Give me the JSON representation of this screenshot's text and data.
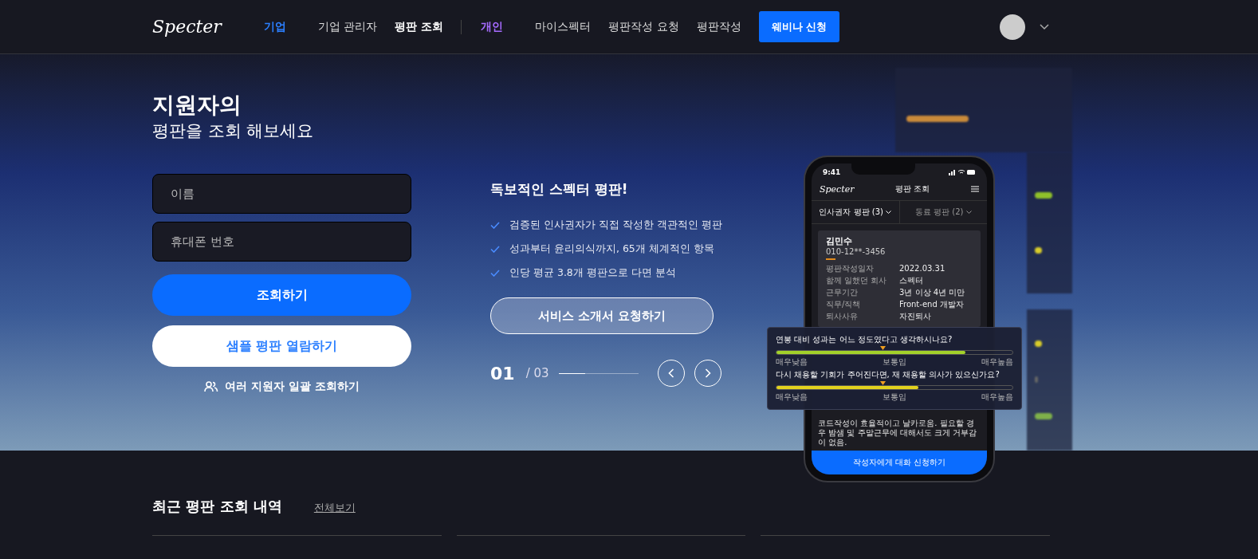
{
  "nav": {
    "logo": "Specter",
    "groups": [
      {
        "label": "기업",
        "color": "#2b7fff",
        "items": [
          {
            "label": "기업 관리자",
            "selected": false
          },
          {
            "label": "평판 조회",
            "selected": true
          }
        ]
      },
      {
        "label": "개인",
        "color": "#a66bff",
        "items": [
          {
            "label": "마이스펙터",
            "selected": false
          },
          {
            "label": "평판작성 요청",
            "selected": false
          },
          {
            "label": "평판작성",
            "selected": false
          }
        ]
      }
    ],
    "cta": "웨비나 신청"
  },
  "hero": {
    "title": "지원자의",
    "subtitle": "평판을 조회 해보세요",
    "fields": [
      {
        "placeholder": "이름"
      },
      {
        "placeholder": "휴대폰 번호"
      }
    ],
    "search_button": "조회하기",
    "sample_button": "샘플 평판 열람하기",
    "bulk_link": "여러 지원자 일괄 조회하기"
  },
  "feature": {
    "heading": "독보적인 스펙터 평판!",
    "points": [
      "검증된 인사권자가 직접 작성한 객관적인 평판",
      "성과부터 윤리의식까지, 65개 체계적인 항목",
      "인당 평균 3.8개 평판으로 다면 분석"
    ],
    "button": "서비스 소개서 요청하기",
    "page": "01",
    "total": "/ 03",
    "progress": {
      "level": 0.33
    }
  },
  "phone": {
    "time": "9:41",
    "logo": "Specter",
    "title": "평판 조회",
    "tabs": [
      {
        "label": "인사권자 평판 (3)",
        "selected": true
      },
      {
        "label": "동료 평판 (2)",
        "selected": false
      }
    ],
    "name": "김민수",
    "number": "010-12**-3456",
    "rows": [
      {
        "label": "평판작성일자",
        "value": "2022.03.31"
      },
      {
        "label": "함께 일했던 회사",
        "value": "스펙터"
      },
      {
        "label": "근무기간",
        "value": "3년 이상 4년 미만"
      },
      {
        "label": "직무/직책",
        "value": "Front-end 개발자"
      },
      {
        "label": "퇴사사유",
        "value": "자진퇴사"
      }
    ],
    "comment": "코드작성이 효율적이고 날카로움. 필요할 경우 밤샘 및 주말근무에 대해서도 크게 거부감이 없음.",
    "button": "작성자에게 대화 신청하기"
  },
  "rating_card": {
    "questions": [
      {
        "text": "연봉 대비 성과는 어느 정도였다고 생각하시나요?",
        "level": 0.8,
        "color": "#a3d12a",
        "low": "매우낮음",
        "mid": "보통임",
        "high": "매우높음"
      },
      {
        "text": "다시 채용할 기회가 주어진다면, 재 채용할 의사가 있으신가요?",
        "level": 0.6,
        "color": "#e3d21e",
        "low": "매우낮음",
        "mid": "보통임",
        "high": "매우높음"
      }
    ]
  },
  "recent": {
    "heading": "최근 평판 조회 내역",
    "link": "전체보기"
  }
}
